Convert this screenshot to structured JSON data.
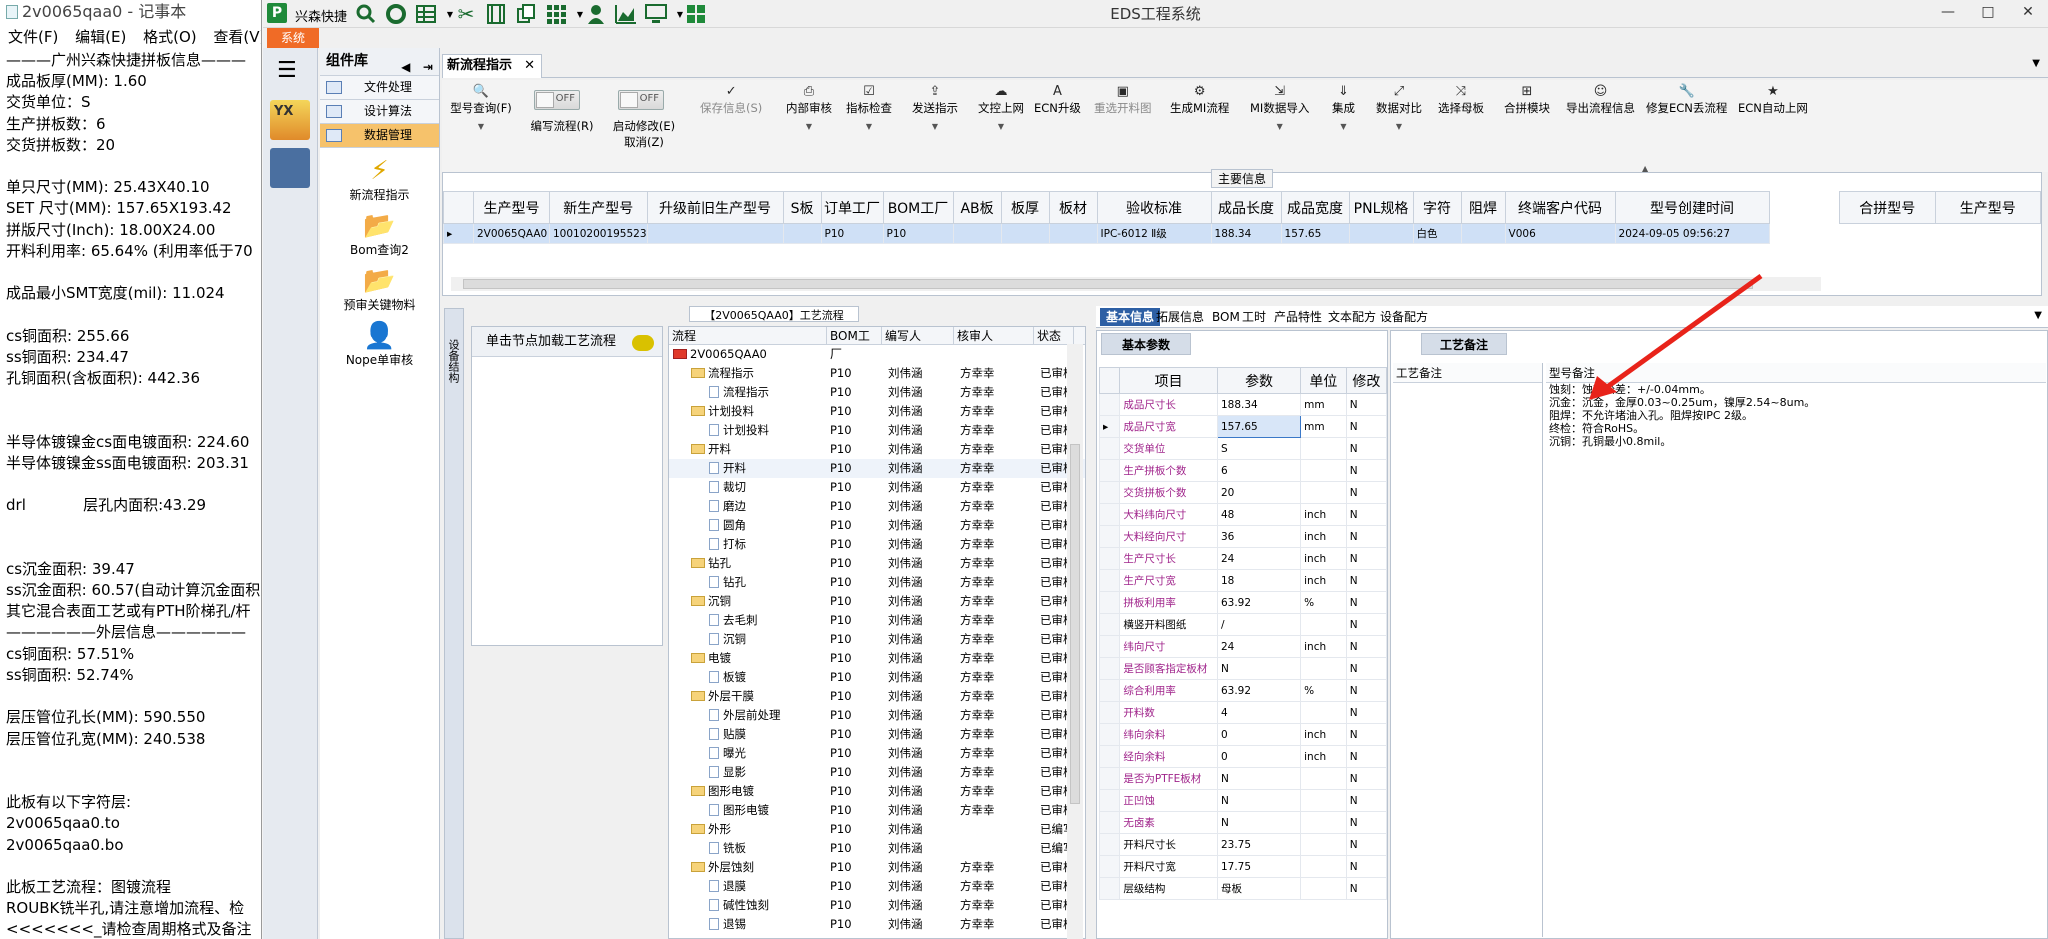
{
  "notepad": {
    "title": "2v0065qaa0 - 记事本",
    "menu": [
      "文件(F)",
      "编辑(E)",
      "格式(O)",
      "查看(V)"
    ],
    "text": "———广州兴森快捷拼板信息———\n成品板厚(MM): 1.60\n交货单位：S\n生产拼板数：6\n交货拼板数：20\n\n单只尺寸(MM): 25.43X40.10\nSET 尺寸(MM): 157.65X193.42\n拼版尺寸(Inch): 18.00X24.00\n开料利用率: 65.64% (利用率低于70\n\n成品最小SMT宽度(mil): 11.024\n\ncs铜面积: 255.66\nss铜面积: 234.47\n孔铜面积(含板面积): 442.36\n\n\n半导体镀镍金cs面电镀面积: 224.60\n半导体镀镍金ss面电镀面积: 203.31\n\ndrl            层孔内面积:43.29\n\n\ncs沉金面积: 39.47\nss沉金面积: 60.57(自动计算沉金面积\n其它混合表面工艺或有PTH阶梯孔/杆\n——————外层信息——————\ncs铜面积: 57.51%\nss铜面积: 52.74%\n\n层压管位孔长(MM): 590.550\n层压管位孔宽(MM): 240.538\n\n\n此板有以下字符层:\n2v0065qaa0.to\n2v0065qaa0.bo\n\n此板工艺流程：图镀流程\nROUBK铣半孔,请注意增加流程、检\n<<<<<<<_请检查周期格式及备注"
  },
  "app": {
    "name": "兴森快捷",
    "title": "EDS工程系统",
    "system_tab": "系统",
    "window_buttons": [
      "—",
      "□",
      "✕"
    ]
  },
  "library": {
    "title": "组件库",
    "categories": [
      "文件处理",
      "设计算法",
      "数据管理"
    ],
    "items": [
      "新流程指示",
      "Bom查询2",
      "预审关键物料",
      "Nope单审核"
    ]
  },
  "doc_tab": {
    "label": "新流程指示",
    "close": "✕"
  },
  "toolbar": {
    "query": "型号查询(F)",
    "write_flow": "编写流程(R)",
    "start_modify": "启动修改(E)",
    "cancel": "取消(Z)",
    "toggle_off": "OFF",
    "items": [
      {
        "label": "保存信息(S)",
        "icon": "✓",
        "disabled": true
      },
      {
        "label": "内部审核",
        "icon": "⎙",
        "disabled": false
      },
      {
        "label": "指标检查",
        "icon": "☑",
        "disabled": false
      },
      {
        "label": "发送指示",
        "icon": "⇪",
        "disabled": false
      },
      {
        "label": "文控上网",
        "icon": "☁",
        "disabled": false
      },
      {
        "label": "ECN升级",
        "icon": "A",
        "disabled": false
      },
      {
        "label": "重选开料图",
        "icon": "▣",
        "disabled": true
      },
      {
        "label": "生成MI流程",
        "icon": "⚙",
        "disabled": false
      },
      {
        "label": "MI数据导入",
        "icon": "⇲",
        "disabled": false
      },
      {
        "label": "集成",
        "icon": "⇓",
        "disabled": false
      },
      {
        "label": "数据对比",
        "icon": "⤢",
        "disabled": false
      },
      {
        "label": "选择母板",
        "icon": "⤨",
        "disabled": false
      },
      {
        "label": "合拼模块",
        "icon": "⊞",
        "disabled": false
      },
      {
        "label": "导出流程信息",
        "icon": "☺",
        "disabled": false
      },
      {
        "label": "修复ECN丢流程",
        "icon": "🔧",
        "disabled": false
      },
      {
        "label": "ECN自动上网",
        "icon": "★",
        "disabled": false
      }
    ]
  },
  "main_info": {
    "title": "主要信息",
    "columns": [
      "生产型号",
      "新生产型号",
      "升级前旧生产型号",
      "S板",
      "订单工厂",
      "BOM工厂",
      "AB板",
      "板厚",
      "板材",
      "验收标准",
      "成品长度",
      "成品宽度",
      "PNL规格",
      "字符",
      "阻焊",
      "终端客户代码",
      "型号创建时间"
    ],
    "row": [
      "2V0065QAA0",
      "10010200195523",
      "",
      "",
      "P10",
      "P10",
      "",
      "",
      "",
      "IPC-6012 Ⅱ级",
      "188.34",
      "157.65",
      "",
      "白色",
      "",
      "V006",
      "2024-09-05 09:56:27"
    ],
    "side_columns": [
      "合拼型号",
      "生产型号"
    ]
  },
  "flow": {
    "side_label": "设备结构",
    "header": "【2V0065QAA0】工艺流程",
    "load_hint": "单击节点加载工艺流程",
    "columns": [
      "流程",
      "BOM工厂",
      "编写人",
      "核审人",
      "状态"
    ],
    "rows": [
      {
        "d": 0,
        "t": "root",
        "name": "2V0065QAA0",
        "bom": "",
        "w": "",
        "r": "",
        "s": ""
      },
      {
        "d": 1,
        "t": "f",
        "name": "流程指示",
        "bom": "P10",
        "w": "刘伟涵",
        "r": "方幸幸",
        "s": "已审核"
      },
      {
        "d": 2,
        "t": "p",
        "name": "流程指示",
        "bom": "P10",
        "w": "刘伟涵",
        "r": "方幸幸",
        "s": "已审核"
      },
      {
        "d": 1,
        "t": "f",
        "name": "计划投料",
        "bom": "P10",
        "w": "刘伟涵",
        "r": "方幸幸",
        "s": "已审核"
      },
      {
        "d": 2,
        "t": "p",
        "name": "计划投料",
        "bom": "P10",
        "w": "刘伟涵",
        "r": "方幸幸",
        "s": "已审核"
      },
      {
        "d": 1,
        "t": "f",
        "name": "开料",
        "bom": "P10",
        "w": "刘伟涵",
        "r": "方幸幸",
        "s": "已审核"
      },
      {
        "d": 2,
        "t": "p",
        "name": "开料",
        "bom": "P10",
        "w": "刘伟涵",
        "r": "方幸幸",
        "s": "已审核",
        "sel": true
      },
      {
        "d": 2,
        "t": "p",
        "name": "裁切",
        "bom": "P10",
        "w": "刘伟涵",
        "r": "方幸幸",
        "s": "已审核"
      },
      {
        "d": 2,
        "t": "p",
        "name": "磨边",
        "bom": "P10",
        "w": "刘伟涵",
        "r": "方幸幸",
        "s": "已审核"
      },
      {
        "d": 2,
        "t": "p",
        "name": "圆角",
        "bom": "P10",
        "w": "刘伟涵",
        "r": "方幸幸",
        "s": "已审核"
      },
      {
        "d": 2,
        "t": "p",
        "name": "打标",
        "bom": "P10",
        "w": "刘伟涵",
        "r": "方幸幸",
        "s": "已审核"
      },
      {
        "d": 1,
        "t": "f",
        "name": "钻孔",
        "bom": "P10",
        "w": "刘伟涵",
        "r": "方幸幸",
        "s": "已审核"
      },
      {
        "d": 2,
        "t": "p",
        "name": "钻孔",
        "bom": "P10",
        "w": "刘伟涵",
        "r": "方幸幸",
        "s": "已审核"
      },
      {
        "d": 1,
        "t": "f",
        "name": "沉铜",
        "bom": "P10",
        "w": "刘伟涵",
        "r": "方幸幸",
        "s": "已审核"
      },
      {
        "d": 2,
        "t": "p",
        "name": "去毛刺",
        "bom": "P10",
        "w": "刘伟涵",
        "r": "方幸幸",
        "s": "已审核"
      },
      {
        "d": 2,
        "t": "p",
        "name": "沉铜",
        "bom": "P10",
        "w": "刘伟涵",
        "r": "方幸幸",
        "s": "已审核"
      },
      {
        "d": 1,
        "t": "f",
        "name": "电镀",
        "bom": "P10",
        "w": "刘伟涵",
        "r": "方幸幸",
        "s": "已审核"
      },
      {
        "d": 2,
        "t": "p",
        "name": "板镀",
        "bom": "P10",
        "w": "刘伟涵",
        "r": "方幸幸",
        "s": "已审核"
      },
      {
        "d": 1,
        "t": "f",
        "name": "外层干膜",
        "bom": "P10",
        "w": "刘伟涵",
        "r": "方幸幸",
        "s": "已审核"
      },
      {
        "d": 2,
        "t": "p",
        "name": "外层前处理",
        "bom": "P10",
        "w": "刘伟涵",
        "r": "方幸幸",
        "s": "已审核"
      },
      {
        "d": 2,
        "t": "p",
        "name": "贴膜",
        "bom": "P10",
        "w": "刘伟涵",
        "r": "方幸幸",
        "s": "已审核"
      },
      {
        "d": 2,
        "t": "p",
        "name": "曝光",
        "bom": "P10",
        "w": "刘伟涵",
        "r": "方幸幸",
        "s": "已审核"
      },
      {
        "d": 2,
        "t": "p",
        "name": "显影",
        "bom": "P10",
        "w": "刘伟涵",
        "r": "方幸幸",
        "s": "已审核"
      },
      {
        "d": 1,
        "t": "f",
        "name": "图形电镀",
        "bom": "P10",
        "w": "刘伟涵",
        "r": "方幸幸",
        "s": "已审核"
      },
      {
        "d": 2,
        "t": "p",
        "name": "图形电镀",
        "bom": "P10",
        "w": "刘伟涵",
        "r": "方幸幸",
        "s": "已审核"
      },
      {
        "d": 1,
        "t": "f",
        "name": "外形",
        "bom": "P10",
        "w": "刘伟涵",
        "r": "",
        "s": "已编写"
      },
      {
        "d": 2,
        "t": "p",
        "name": "铣板",
        "bom": "P10",
        "w": "刘伟涵",
        "r": "",
        "s": "已编写"
      },
      {
        "d": 1,
        "t": "f",
        "name": "外层蚀刻",
        "bom": "P10",
        "w": "刘伟涵",
        "r": "方幸幸",
        "s": "已审核"
      },
      {
        "d": 2,
        "t": "p",
        "name": "退膜",
        "bom": "P10",
        "w": "刘伟涵",
        "r": "方幸幸",
        "s": "已审核"
      },
      {
        "d": 2,
        "t": "p",
        "name": "碱性蚀刻",
        "bom": "P10",
        "w": "刘伟涵",
        "r": "方幸幸",
        "s": "已审核"
      },
      {
        "d": 2,
        "t": "p",
        "name": "退锡",
        "bom": "P10",
        "w": "刘伟涵",
        "r": "方幸幸",
        "s": "已审核"
      }
    ]
  },
  "right_tabs": [
    "基本信息",
    "拓展信息",
    "BOM",
    "工时",
    "产品特性",
    "文本配方",
    "设备配方"
  ],
  "basic": {
    "subtab": "基本参数",
    "columns": [
      "项目",
      "参数",
      "单位",
      "修改"
    ],
    "rows": [
      {
        "name": "成品尺寸长",
        "val": "188.34",
        "unit": "mm",
        "mod": "N",
        "c": "m"
      },
      {
        "name": "成品尺寸宽",
        "val": "157.65",
        "unit": "mm",
        "mod": "N",
        "c": "m",
        "cur": true
      },
      {
        "name": "交货单位",
        "val": "S",
        "unit": "",
        "mod": "N",
        "c": "m"
      },
      {
        "name": "生产拼板个数",
        "val": "6",
        "unit": "",
        "mod": "N",
        "c": "m"
      },
      {
        "name": "交货拼板个数",
        "val": "20",
        "unit": "",
        "mod": "N",
        "c": "m"
      },
      {
        "name": "大料纬向尺寸",
        "val": "48",
        "unit": "inch",
        "mod": "N",
        "c": "m"
      },
      {
        "name": "大料经向尺寸",
        "val": "36",
        "unit": "inch",
        "mod": "N",
        "c": "m"
      },
      {
        "name": "生产尺寸长",
        "val": "24",
        "unit": "inch",
        "mod": "N",
        "c": "m"
      },
      {
        "name": "生产尺寸宽",
        "val": "18",
        "unit": "inch",
        "mod": "N",
        "c": "m"
      },
      {
        "name": "拼板利用率",
        "val": "63.92",
        "unit": "%",
        "mod": "N",
        "c": "m"
      },
      {
        "name": "横竖开料图纸",
        "val": "/",
        "unit": "",
        "mod": "N",
        "c": "k"
      },
      {
        "name": "纬向尺寸",
        "val": "24",
        "unit": "inch",
        "mod": "N",
        "c": "m"
      },
      {
        "name": "是否顾客指定板材",
        "val": "N",
        "unit": "",
        "mod": "N",
        "c": "m"
      },
      {
        "name": "综合利用率",
        "val": "63.92",
        "unit": "%",
        "mod": "N",
        "c": "m"
      },
      {
        "name": "开料数",
        "val": "4",
        "unit": "",
        "mod": "N",
        "c": "m"
      },
      {
        "name": "纬向余料",
        "val": "0",
        "unit": "inch",
        "mod": "N",
        "c": "m"
      },
      {
        "name": "经向余料",
        "val": "0",
        "unit": "inch",
        "mod": "N",
        "c": "m"
      },
      {
        "name": "是否为PTFE板材",
        "val": "N",
        "unit": "",
        "mod": "N",
        "c": "m"
      },
      {
        "name": "正凹蚀",
        "val": "N",
        "unit": "",
        "mod": "N",
        "c": "m"
      },
      {
        "name": "无卤素",
        "val": "N",
        "unit": "",
        "mod": "N",
        "c": "m"
      },
      {
        "name": "开料尺寸长",
        "val": "23.75",
        "unit": "",
        "mod": "N",
        "c": "k"
      },
      {
        "name": "开料尺寸宽",
        "val": "17.75",
        "unit": "",
        "mod": "N",
        "c": "k"
      },
      {
        "name": "层级结构",
        "val": "母板",
        "unit": "",
        "mod": "N",
        "c": "k"
      }
    ]
  },
  "memo": {
    "subtab": "工艺备注",
    "left_header": "工艺备注",
    "right_header": "型号备注",
    "text": "蚀刻：蚀刻公差：+/-0.04mm。\n沉金：沉金，金厚0.03~0.25um，镍厚2.54~8um。\n阻焊：不允许堵油入孔。阻焊按IPC 2级。\n终检：符合RoHS。\n沉铜：孔铜最小0.8mil。"
  },
  "colors": {
    "accent": "#2d5fa4",
    "selected": "#cfe0f6",
    "orange": "#f06b26",
    "annotation": "#e8231a"
  }
}
